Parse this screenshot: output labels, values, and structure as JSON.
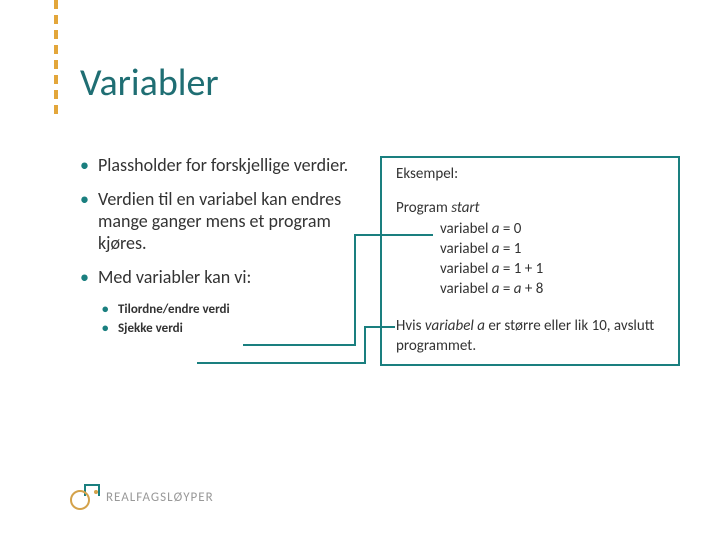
{
  "title": "Variabler",
  "bullets": {
    "b1": "Plassholder for forskjellige verdier.",
    "b2": "Verdien til en variabel kan endres mange ganger mens et program kjøres.",
    "b3": "Med variabler kan vi:",
    "sub1": "Tilordne/endre verdi",
    "sub2": "Sjekke verdi"
  },
  "example": {
    "header": "Eksempel:",
    "program_label": "Program ",
    "program_start": "start",
    "line1_a": "variabel ",
    "line1_b": "a",
    "line1_c": " = 0",
    "line2_a": "variabel ",
    "line2_b": "a",
    "line2_c": " = 1",
    "line3_a": "variabel ",
    "line3_b": "a",
    "line3_c": " = 1 + 1",
    "line4_a": "variabel ",
    "line4_b": "a",
    "line4_c": " = ",
    "line4_d": "a",
    "line4_e": " + 8",
    "cond_a": "Hvis ",
    "cond_b": "variabel a",
    "cond_c": " er større eller lik 10, avslutt programmet."
  },
  "logo_text": "REALFAGSLØYPER"
}
